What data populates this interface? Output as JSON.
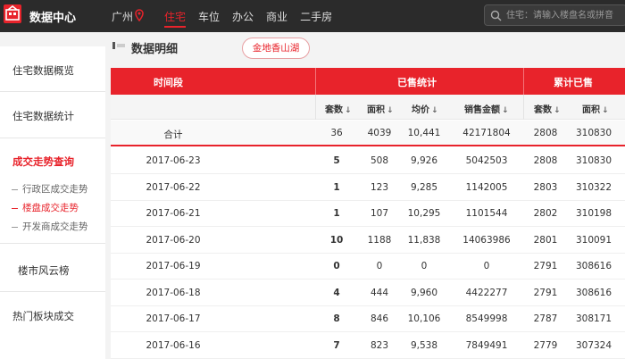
{
  "app": {
    "title": "数据中心",
    "city": "广州"
  },
  "colors": {
    "accent": "#e8232b",
    "topbar": "#2b2b2b"
  },
  "nav": {
    "items": [
      "住宅",
      "车位",
      "办公",
      "商业",
      "二手房"
    ],
    "active": "住宅"
  },
  "search": {
    "placeholder": "住宅：请输入楼盘名或拼音"
  },
  "sidebar": {
    "items": [
      "住宅数据概览",
      "住宅数据统计",
      "成交走势查询",
      "楼市风云榜",
      "热门板块成交"
    ],
    "active": "成交走势查询",
    "subitems": [
      "行政区成交走势",
      "楼盘成交走势",
      "开发商成交走势"
    ],
    "active_sub": "楼盘成交走势"
  },
  "main": {
    "section_title": "数据明细",
    "tag_button": "金地香山湖"
  },
  "table": {
    "group_headers": {
      "period": "时间段",
      "sold": "已售统计",
      "cumulative": "累计已售"
    },
    "columns": [
      "套数",
      "面积",
      "均价",
      "销售金额",
      "套数",
      "面积"
    ],
    "sort_icon": "↓",
    "total": [
      "合计",
      "36",
      "4039",
      "10,441",
      "42171804",
      "2808",
      "310830"
    ],
    "rows": [
      [
        "2017-06-23",
        "5",
        "508",
        "9,926",
        "5042503",
        "2808",
        "310830"
      ],
      [
        "2017-06-22",
        "1",
        "123",
        "9,285",
        "1142005",
        "2803",
        "310322"
      ],
      [
        "2017-06-21",
        "1",
        "107",
        "10,295",
        "1101544",
        "2802",
        "310198"
      ],
      [
        "2017-06-20",
        "10",
        "1188",
        "11,838",
        "14063986",
        "2801",
        "310091"
      ],
      [
        "2017-06-19",
        "0",
        "0",
        "0",
        "0",
        "2791",
        "308616"
      ],
      [
        "2017-06-18",
        "4",
        "444",
        "9,960",
        "4422277",
        "2791",
        "308616"
      ],
      [
        "2017-06-17",
        "8",
        "846",
        "10,106",
        "8549998",
        "2787",
        "308171"
      ],
      [
        "2017-06-16",
        "7",
        "823",
        "9,538",
        "7849491",
        "2779",
        "307324"
      ]
    ]
  }
}
